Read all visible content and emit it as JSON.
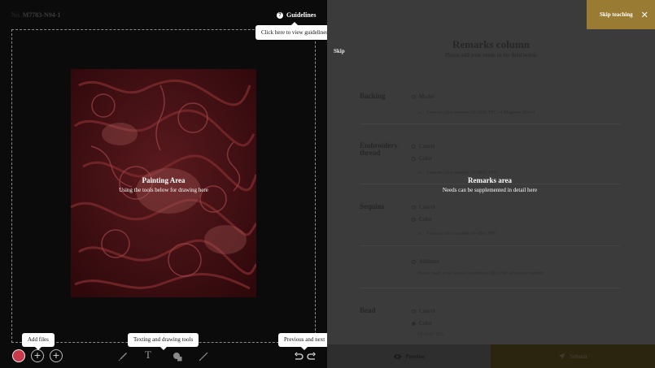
{
  "header": {
    "sku_label": "No.",
    "sku_value": "M7783-N94-1",
    "guidelines_label": "Guidelines"
  },
  "tooltips": {
    "guidelines": "Click here to view guidelines",
    "add_files": "Add files",
    "drawing_tools": "Texting and drawing tools",
    "prev_next": "Previous and next"
  },
  "painting_area": {
    "title": "Painting Area",
    "subtitle": "Using the tools below for drawing here"
  },
  "toolbar": {
    "color": "#c8394b",
    "add_symbol": "+",
    "text_tool": "T",
    "icons": [
      "brush-icon",
      "text-icon",
      "shapes-icon",
      "line-icon",
      "undo-icon",
      "redo-icon"
    ]
  },
  "right_panel": {
    "skip_label": "Skip",
    "skip_teaching_label": "Skip teaching",
    "close_symbol": "✕",
    "title": "Remarks column",
    "subtitle": "Please add your needs in the field below",
    "remarks_area_title": "Remarks area",
    "remarks_area_subtitle": "Needs can be supplemented in detail here",
    "backing": {
      "title": "Backing",
      "option": "Model",
      "note": "or：Pantone color number 19-4041 TPG or Magenta N94-4"
    },
    "embroidery": {
      "title": "Embroidery thread",
      "options": [
        "Cancel",
        "Color"
      ],
      "note": "or：Pantone color number 19-4041 TPG"
    },
    "sequins": {
      "title": "Sequins",
      "options": [
        "Cancel",
        "Color"
      ],
      "note": "or：Pantone color number 19-4041 TPG"
    },
    "addition": {
      "option": "Addition",
      "note": "Please mark your desired location in fill in the reference number"
    },
    "bead": {
      "title": "Bead",
      "options": [
        "Cancel",
        "Color"
      ],
      "note": "19-4041 TPG"
    },
    "preview_label": "Preview",
    "submit_label": "Submit"
  },
  "colors": {
    "accent_gold": "#9a7b33",
    "left_bg": "#0b0b0b",
    "right_bg": "#3b3b3b"
  }
}
